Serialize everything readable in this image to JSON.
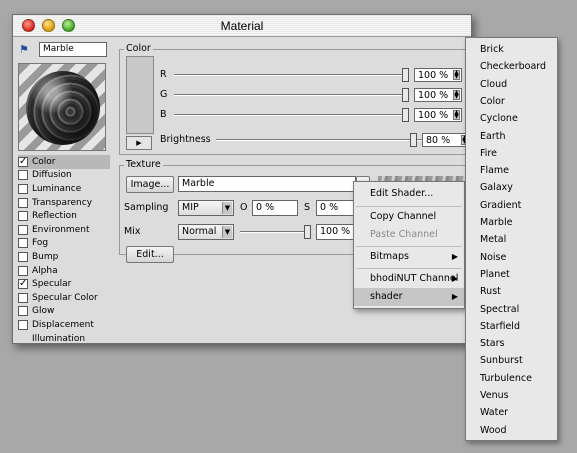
{
  "window": {
    "title": "Material"
  },
  "material": {
    "name": "Marble",
    "icon": "material-tag-icon",
    "channels": [
      {
        "label": "Color",
        "checked": true,
        "selected": true,
        "has_box": true
      },
      {
        "label": "Diffusion",
        "checked": false,
        "selected": false,
        "has_box": true
      },
      {
        "label": "Luminance",
        "checked": false,
        "selected": false,
        "has_box": true
      },
      {
        "label": "Transparency",
        "checked": false,
        "selected": false,
        "has_box": true
      },
      {
        "label": "Reflection",
        "checked": false,
        "selected": false,
        "has_box": true
      },
      {
        "label": "Environment",
        "checked": false,
        "selected": false,
        "has_box": true
      },
      {
        "label": "Fog",
        "checked": false,
        "selected": false,
        "has_box": true
      },
      {
        "label": "Bump",
        "checked": false,
        "selected": false,
        "has_box": true
      },
      {
        "label": "Alpha",
        "checked": false,
        "selected": false,
        "has_box": true
      },
      {
        "label": "Specular",
        "checked": true,
        "selected": false,
        "has_box": true
      },
      {
        "label": "Specular Color",
        "checked": false,
        "selected": false,
        "has_box": true
      },
      {
        "label": "Glow",
        "checked": false,
        "selected": false,
        "has_box": true
      },
      {
        "label": "Displacement",
        "checked": false,
        "selected": false,
        "has_box": true
      },
      {
        "label": "Illumination",
        "checked": false,
        "selected": false,
        "has_box": false
      }
    ]
  },
  "color": {
    "group_label": "Color",
    "r": {
      "label": "R",
      "value": "100 %",
      "level": 1.0
    },
    "g": {
      "label": "G",
      "value": "100 %",
      "level": 1.0
    },
    "b": {
      "label": "B",
      "value": "100 %",
      "level": 1.0
    },
    "brightness": {
      "label": "Brightness",
      "value": "80 %",
      "level": 0.8
    },
    "swatch_color": "#c8c8c8"
  },
  "texture": {
    "group_label": "Texture",
    "image_button": "Image...",
    "texture_name": "Marble",
    "sampling_label": "Sampling",
    "sampling_value": "MIP",
    "o_label": "O",
    "o_value": "0 %",
    "s_label": "S",
    "s_value": "0 %",
    "mix_label": "Mix",
    "mix_mode": "Normal",
    "mix_value": "100 %",
    "mix_level": 1.0,
    "edit_button": "Edit..."
  },
  "context_menu": {
    "edit_shader": "Edit Shader...",
    "copy_channel": "Copy Channel",
    "paste_channel": "Paste Channel",
    "bitmaps": "Bitmaps",
    "bhodinut_channel": "bhodiNUT Channel",
    "shader": "shader"
  },
  "shader_submenu": [
    "Brick",
    "Checkerboard",
    "Cloud",
    "Color",
    "Cyclone",
    "Earth",
    "Fire",
    "Flame",
    "Galaxy",
    "Gradient",
    "Marble",
    "Metal",
    "Noise",
    "Planet",
    "Rust",
    "Spectral",
    "Starfield",
    "Stars",
    "Sunburst",
    "Turbulence",
    "Venus",
    "Water",
    "Wood"
  ]
}
